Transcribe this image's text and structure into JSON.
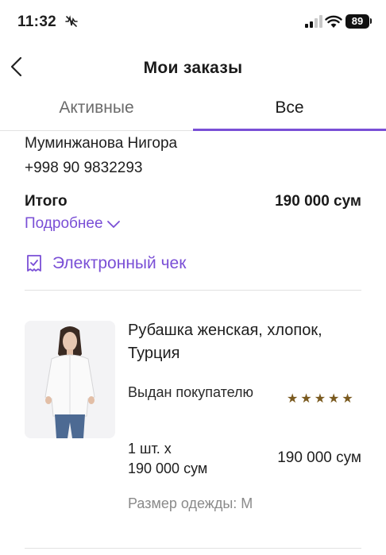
{
  "status_bar": {
    "time": "11:32",
    "battery": "89"
  },
  "header": {
    "title": "Мои заказы"
  },
  "tabs": [
    {
      "label": "Активные",
      "active": false
    },
    {
      "label": "Все",
      "active": true
    }
  ],
  "order": {
    "customer_name": "Муминжанова Нигора",
    "customer_phone": "+998 90 9832293",
    "total_label": "Итого",
    "total_value": "190 000 сум",
    "details_label": "Подробнее",
    "receipt_label": "Электронный чек"
  },
  "product": {
    "name": "Рубашка женская, хлопок, Турция",
    "status": "Выдан покупателю",
    "rating": 5,
    "quantity_line1": "1 шт. x",
    "quantity_line2": "190 000 сум",
    "line_total": "190 000 сум",
    "size": "Размер одежды: M"
  },
  "colors": {
    "accent": "#7a4fd6",
    "star": "#7a5a1f"
  }
}
